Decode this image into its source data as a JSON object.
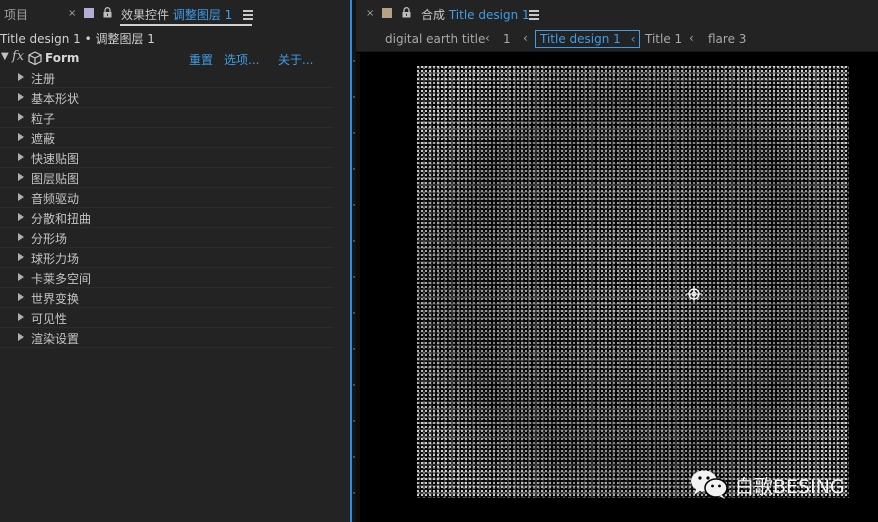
{
  "left_panel": {
    "project_tab": "项目",
    "effects_tab": {
      "close": "×",
      "prefix": "效果控件",
      "layer": "调整图层 1"
    },
    "layer_line": "Title design 1 • 调整图层 1",
    "effect": {
      "name": "Form",
      "fx_label": "fx",
      "reset": "重置",
      "options": "选项...",
      "about": "关于..."
    },
    "properties": [
      "注册",
      "基本形状",
      "粒子",
      "遮蔽",
      "快速贴图",
      "图层贴图",
      "音频驱动",
      "分散和扭曲",
      "分形场",
      "球形力场",
      "卡莱多空间",
      "世界变换",
      "可见性",
      "渲染设置"
    ]
  },
  "right_panel": {
    "comp_tab": {
      "close": "×",
      "prefix": "合成",
      "name": "Title design 1"
    },
    "breadcrumb": {
      "items": [
        "digital earth title",
        "1",
        "Title design 1",
        "Title 1",
        "flare 3"
      ],
      "separator": "‹",
      "active": "Title design 1"
    }
  },
  "watermark": {
    "text": "白歌BESING"
  },
  "colors": {
    "accent": "#3f9de8",
    "effects_swatch": "#b4acd4",
    "comp_swatch": "#b3a283",
    "panel_bg": "#232323",
    "viewer_bg": "#000000"
  },
  "icons": {
    "lock": "lock-icon",
    "menu": "hamburger-menu-icon",
    "expand": "triangle-right-icon",
    "effect_cube": "cube-icon",
    "anchor": "anchor-point-icon",
    "wechat": "wechat-icon"
  }
}
